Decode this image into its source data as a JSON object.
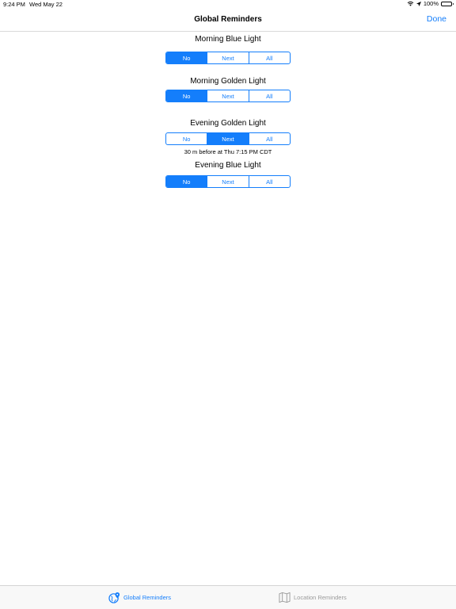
{
  "status_bar": {
    "time": "9:24 PM",
    "date": "Wed May 22",
    "battery": "100%"
  },
  "nav": {
    "title": "Global Reminders",
    "done_label": "Done"
  },
  "options": [
    "No",
    "Next",
    "All"
  ],
  "sections": [
    {
      "title": "Morning Blue Light",
      "selected": "No"
    },
    {
      "title": "Morning Golden Light",
      "selected": "No"
    },
    {
      "title": "Evening Golden Light",
      "selected": "Next",
      "detail": "30 m before at Thu 7:15 PM CDT"
    },
    {
      "title": "Evening Blue Light",
      "selected": "No"
    }
  ],
  "tabs": [
    {
      "label": "Global Reminders",
      "icon": "globe-pin-icon",
      "active": true
    },
    {
      "label": "Location Reminders",
      "icon": "map-icon",
      "active": false
    }
  ],
  "colors": {
    "accent": "#147efb"
  }
}
